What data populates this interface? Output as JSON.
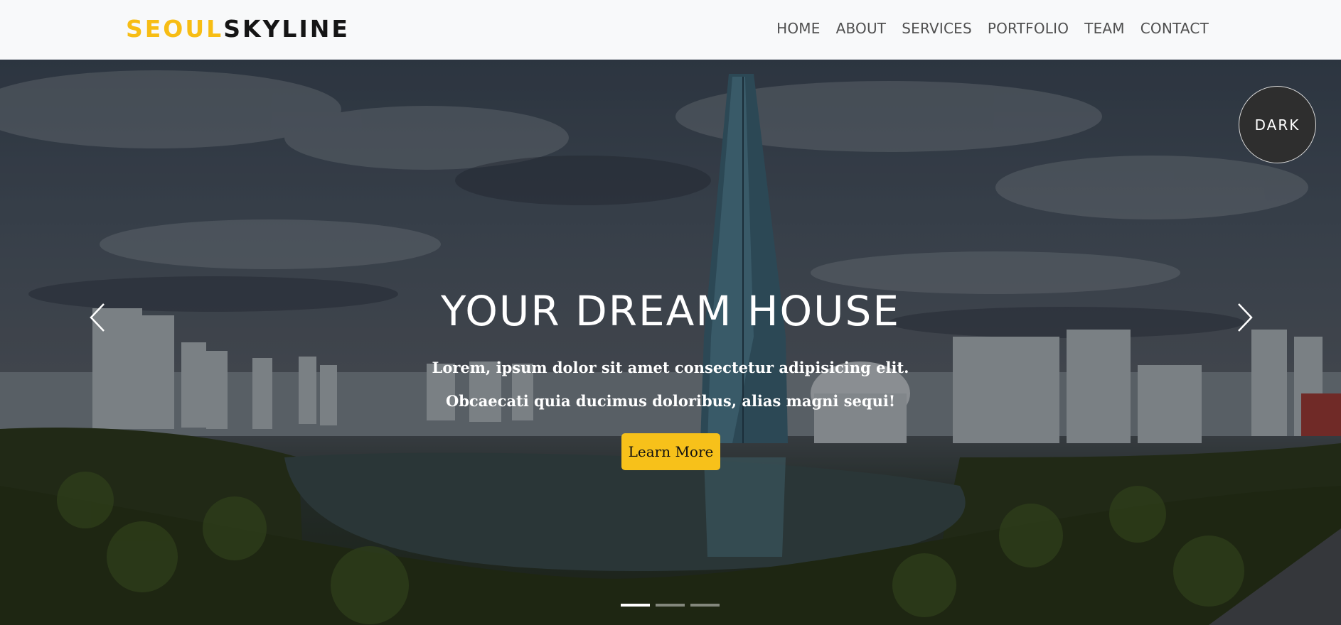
{
  "navbar": {
    "brand_part1": "SEOUL",
    "brand_part2": "SKYLINE",
    "links": [
      "HOME",
      "ABOUT",
      "SERVICES",
      "PORTFOLIO",
      "TEAM",
      "CONTACT"
    ]
  },
  "hero": {
    "title": "YOUR DREAM HOUSE",
    "text": "Lorem, ipsum dolor sit amet consectetur adipisicing elit. Obcaecati quia ducimus doloribus, alias magni sequi!",
    "cta_label": "Learn More",
    "prev_icon": "chevron-left-icon",
    "next_icon": "chevron-right-icon",
    "active_slide": 1,
    "slide_count": 3
  },
  "theme_toggle": {
    "label": "DARK"
  },
  "colors": {
    "accent": "#f7c11a",
    "brand_dark": "#151515",
    "navbar_bg": "#f8f9fa",
    "nav_text": "#4f4f4f"
  }
}
